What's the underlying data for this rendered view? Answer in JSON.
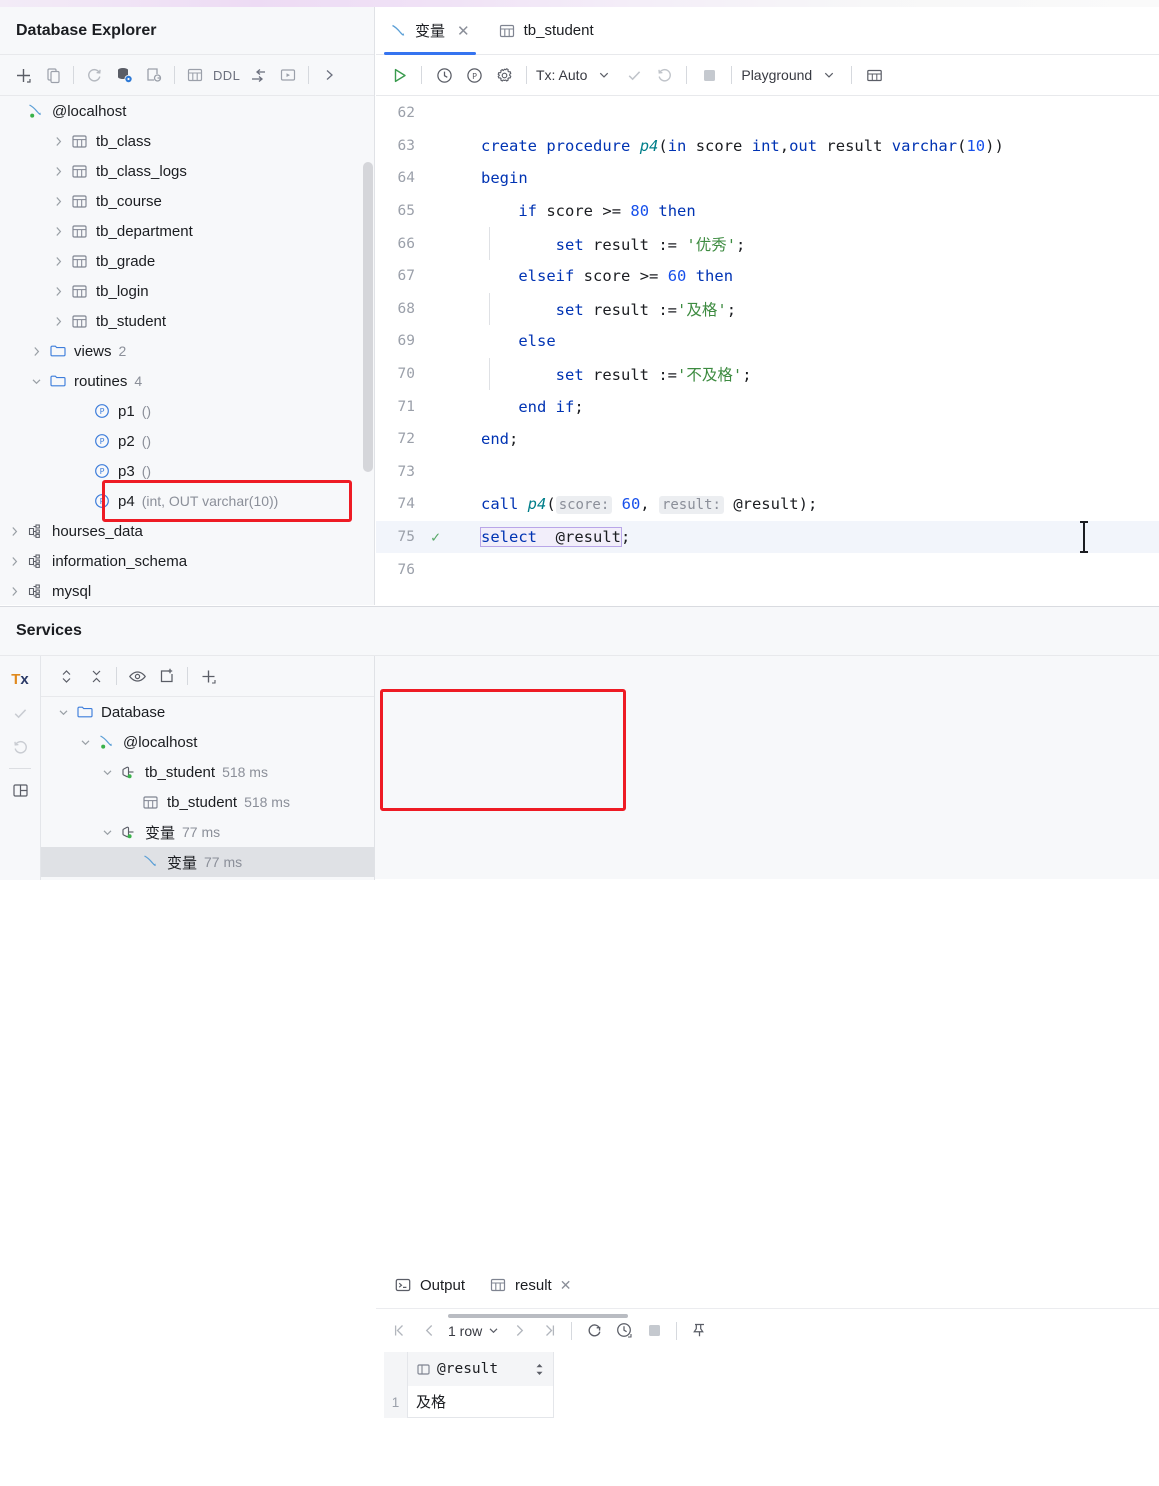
{
  "colors": {
    "accent": "#3574f0",
    "annotation": "#ee1b24",
    "keyword": "#0033b3",
    "string": "#3d8b40",
    "number": "#1750eb",
    "function": "#007e8a",
    "run_green": "#59a869"
  },
  "left_panel": {
    "title": "Database Explorer",
    "toolbar": [
      {
        "name": "add-icon",
        "label": "+"
      },
      {
        "name": "copy-icon",
        "label": ""
      },
      {
        "name": "refresh-icon",
        "label": ""
      },
      {
        "name": "database-settings-icon",
        "label": ""
      },
      {
        "name": "new-query-console-icon",
        "label": ""
      },
      {
        "name": "table-icon",
        "label": ""
      },
      {
        "name": "ddl-button",
        "label": "DDL"
      },
      {
        "name": "jump-to-icon",
        "label": ""
      },
      {
        "name": "run-script-icon",
        "label": ""
      },
      {
        "name": "expand-toolbar-icon",
        "label": ""
      }
    ],
    "tree": [
      {
        "indent": 0,
        "chevron": "",
        "icon": "mysql-icon",
        "label": "@localhost",
        "sub": ""
      },
      {
        "indent": 2,
        "chevron": "right",
        "icon": "table-icon",
        "label": "tb_class",
        "sub": ""
      },
      {
        "indent": 2,
        "chevron": "right",
        "icon": "table-icon",
        "label": "tb_class_logs",
        "sub": ""
      },
      {
        "indent": 2,
        "chevron": "right",
        "icon": "table-icon",
        "label": "tb_course",
        "sub": ""
      },
      {
        "indent": 2,
        "chevron": "right",
        "icon": "table-icon",
        "label": "tb_department",
        "sub": ""
      },
      {
        "indent": 2,
        "chevron": "right",
        "icon": "table-icon",
        "label": "tb_grade",
        "sub": ""
      },
      {
        "indent": 2,
        "chevron": "right",
        "icon": "table-icon",
        "label": "tb_login",
        "sub": ""
      },
      {
        "indent": 2,
        "chevron": "right",
        "icon": "table-icon",
        "label": "tb_student",
        "sub": ""
      },
      {
        "indent": 1,
        "chevron": "right",
        "icon": "folder-icon",
        "label": "views",
        "sub": "2"
      },
      {
        "indent": 1,
        "chevron": "down",
        "icon": "folder-icon",
        "label": "routines",
        "sub": "4"
      },
      {
        "indent": 3,
        "chevron": "",
        "icon": "procedure-icon",
        "label": "p1",
        "sub": "()"
      },
      {
        "indent": 3,
        "chevron": "",
        "icon": "procedure-icon",
        "label": "p2",
        "sub": "()"
      },
      {
        "indent": 3,
        "chevron": "",
        "icon": "procedure-icon",
        "label": "p3",
        "sub": "()"
      },
      {
        "indent": 3,
        "chevron": "",
        "icon": "procedure-icon",
        "label": "p4",
        "sub": "(int, OUT varchar(10))",
        "highlighted": true
      },
      {
        "indent": 0,
        "chevron": "right",
        "icon": "schema-icon",
        "label": "hourses_data",
        "sub": ""
      },
      {
        "indent": 0,
        "chevron": "right",
        "icon": "schema-icon",
        "label": "information_schema",
        "sub": ""
      },
      {
        "indent": 0,
        "chevron": "right",
        "icon": "schema-icon",
        "label": "mysql",
        "sub": ""
      }
    ]
  },
  "editor": {
    "tabs": [
      {
        "label": "变量",
        "icon": "mysql-console-icon",
        "active": true,
        "closable": true
      },
      {
        "label": "tb_student",
        "icon": "table-icon",
        "active": false,
        "closable": false
      }
    ],
    "toolbar": {
      "run_icon": "run-play-icon",
      "history_icon": "history-clock-icon",
      "profile_icon": "profiler-icon",
      "settings_icon": "gear-icon",
      "tx_label": "Tx: Auto",
      "commit_icon": "commit-check-icon",
      "rollback_icon": "rollback-icon",
      "stop_icon": "stop-square-icon",
      "schema_label": "Playground",
      "grid_icon": "open-in-grid-icon"
    },
    "lines": [
      {
        "n": "62",
        "marker": "",
        "html": "",
        "indent_guide": false
      },
      {
        "n": "63",
        "marker": "",
        "html": "<span class='kw'>create</span> <span class='kw'>procedure</span> <span class='fn'>p4</span>(<span class='kw'>in</span> <span class='ident'>score</span> <span class='kw'>int</span>,<span class='kw'>out</span> <span class='ident'>result</span> <span class='kw'>varchar</span>(<span class='num'>10</span>))",
        "indent_guide": false
      },
      {
        "n": "64",
        "marker": "",
        "html": "<span class='kw'>begin</span>",
        "indent_guide": false
      },
      {
        "n": "65",
        "marker": "",
        "html": "    <span class='kw'>if</span> <span class='ident'>score</span> <span class='ident'>&gt;=</span> <span class='num'>80</span> <span class='kw'>then</span>",
        "indent_guide": false
      },
      {
        "n": "66",
        "marker": "",
        "html": "        <span class='kw'>set</span> <span class='ident'>result</span> <span class='ident'>:=</span> <span class='str'>'优秀'</span>;",
        "indent_guide": true
      },
      {
        "n": "67",
        "marker": "",
        "html": "    <span class='kw'>elseif</span> <span class='ident'>score</span> <span class='ident'>&gt;=</span> <span class='num'>60</span> <span class='kw'>then</span>",
        "indent_guide": false
      },
      {
        "n": "68",
        "marker": "",
        "html": "        <span class='kw'>set</span> <span class='ident'>result</span> <span class='ident'>:=</span><span class='str'>'及格'</span>;",
        "indent_guide": true
      },
      {
        "n": "69",
        "marker": "",
        "html": "    <span class='kw'>else</span>",
        "indent_guide": false
      },
      {
        "n": "70",
        "marker": "",
        "html": "        <span class='kw'>set</span> <span class='ident'>result</span> <span class='ident'>:=</span><span class='str'>'不及格'</span>;",
        "indent_guide": true
      },
      {
        "n": "71",
        "marker": "",
        "html": "    <span class='kw'>end</span> <span class='kw'>if</span>;",
        "indent_guide": false
      },
      {
        "n": "72",
        "marker": "",
        "html": "<span class='kw'>end</span>;",
        "indent_guide": false
      },
      {
        "n": "73",
        "marker": "",
        "html": "",
        "indent_guide": false
      },
      {
        "n": "74",
        "marker": "",
        "html": "<span class='kw'>call</span> <span class='fn'>p4</span>(<span class='hint'>score:</span> <span class='num'>60</span>, <span class='hint'>result:</span> <span class='ident'>@result</span>);",
        "indent_guide": false
      },
      {
        "n": "75",
        "marker": "✓",
        "html": "<span class='selbox'><span class='kw'>select</span>  <span class='ident'>@result</span></span>;",
        "indent_guide": false,
        "highlight": true
      },
      {
        "n": "76",
        "marker": "",
        "html": "",
        "indent_guide": false
      }
    ]
  },
  "services": {
    "title": "Services",
    "rail": [
      {
        "name": "tx-icon",
        "label": "Tx"
      },
      {
        "name": "commit-check-icon",
        "label": ""
      },
      {
        "name": "rollback-icon",
        "label": ""
      },
      {
        "name": "layout-toggle-icon",
        "label": ""
      }
    ],
    "toolbar": [
      {
        "name": "expand-collapse-icon"
      },
      {
        "name": "collapse-all-icon"
      },
      {
        "name": "eye-icon"
      },
      {
        "name": "new-tab-icon"
      },
      {
        "name": "add-icon"
      }
    ],
    "tree": [
      {
        "indent": 0,
        "chevron": "down",
        "icon": "folder-icon",
        "label": "Database",
        "time": ""
      },
      {
        "indent": 1,
        "chevron": "down",
        "icon": "mysql-icon",
        "label": "@localhost",
        "time": ""
      },
      {
        "indent": 2,
        "chevron": "down",
        "icon": "connection-icon",
        "label": "tb_student",
        "time": "518 ms"
      },
      {
        "indent": 3,
        "chevron": "",
        "icon": "table-icon",
        "label": "tb_student",
        "time": "518 ms"
      },
      {
        "indent": 2,
        "chevron": "down",
        "icon": "connection-icon",
        "label": "变量",
        "time": "77 ms"
      },
      {
        "indent": 3,
        "chevron": "",
        "icon": "mysql-console-icon",
        "label": "变量",
        "time": "77 ms",
        "selected": true
      }
    ]
  },
  "results": {
    "tabs": [
      {
        "label": "Output",
        "icon": "console-output-icon",
        "active": false,
        "closable": false
      },
      {
        "label": "result",
        "icon": "table-icon",
        "active": true,
        "closable": true
      }
    ],
    "toolbar": {
      "first_page_icon": "first-page-icon",
      "prev_page_icon": "prev-page-icon",
      "row_count": "1 row",
      "next_page_icon": "next-page-icon",
      "last_page_icon": "last-page-icon",
      "refresh_icon": "refresh-icon",
      "history_icon": "history-clock-icon",
      "stop_icon": "stop-square-icon",
      "pin_icon": "pin-icon"
    },
    "grid": {
      "columns": [
        "@result"
      ],
      "rows": [
        {
          "num": "1",
          "cells": [
            "及格"
          ]
        }
      ]
    }
  }
}
